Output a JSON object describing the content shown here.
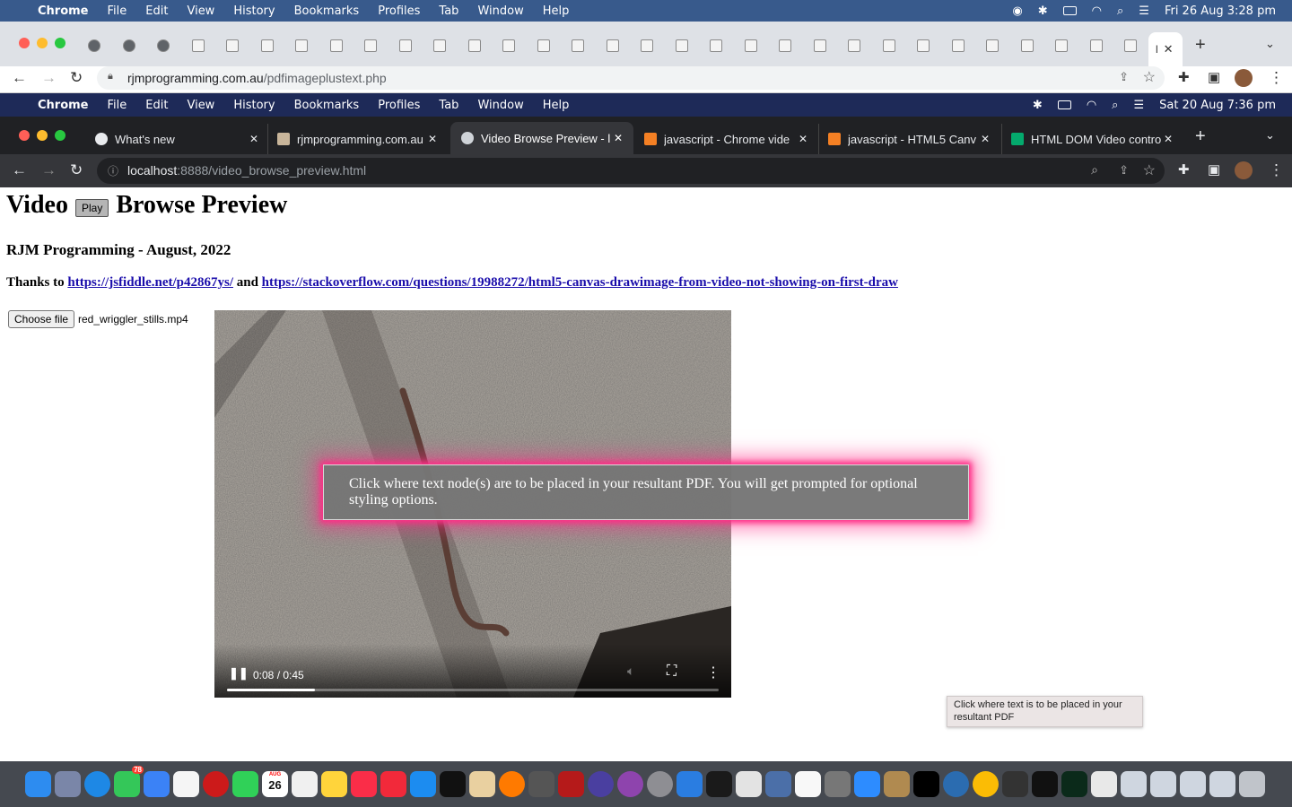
{
  "outer_menubar": {
    "items": [
      "Chrome",
      "File",
      "Edit",
      "View",
      "History",
      "Bookmarks",
      "Profiles",
      "Tab",
      "Window",
      "Help"
    ],
    "clock": "Fri 26 Aug  3:28 pm"
  },
  "outer_address": {
    "domain": "rjmprogramming.com.au",
    "path": "/pdfimageplustext.php"
  },
  "inner_menubar": {
    "items": [
      "Chrome",
      "File",
      "Edit",
      "View",
      "History",
      "Bookmarks",
      "Profiles",
      "Tab",
      "Window",
      "Help"
    ],
    "clock": "Sat 20 Aug  7:36 pm"
  },
  "inner_tabs": [
    {
      "label": "What's new"
    },
    {
      "label": "rjmprogramming.com.au"
    },
    {
      "label": "Video Browse Preview - l"
    },
    {
      "label": "javascript - Chrome vide"
    },
    {
      "label": "javascript - HTML5 Canv"
    },
    {
      "label": "HTML DOM Video contro"
    }
  ],
  "inner_address": {
    "host": "localhost",
    "path": ":8888/video_browse_preview.html"
  },
  "page": {
    "title_left": "Video",
    "play_label": "Play",
    "title_right": "Browse Preview",
    "subtitle": "RJM Programming - August, 2022",
    "thanks_prefix": "Thanks to",
    "link1": "https://jsfiddle.net/p42867ys/",
    "thanks_and": "and",
    "link2": "https://stackoverflow.com/questions/19988272/html5-canvas-drawimage-from-video-not-showing-on-first-draw",
    "choose_file": "Choose file",
    "file_name": "red_wriggler_stills.mp4"
  },
  "video": {
    "time": "0:08 / 0:45",
    "progress_fraction": 0.178
  },
  "overlay": {
    "message": "Click where text node(s) are to be placed in your resultant PDF. You will get prompted for optional styling options."
  },
  "tooltip": {
    "text": "Click where text is to be placed in your resultant PDF"
  },
  "dock_badges": {
    "messages": "78",
    "calendar_month": "AUG",
    "calendar_day": "26"
  }
}
